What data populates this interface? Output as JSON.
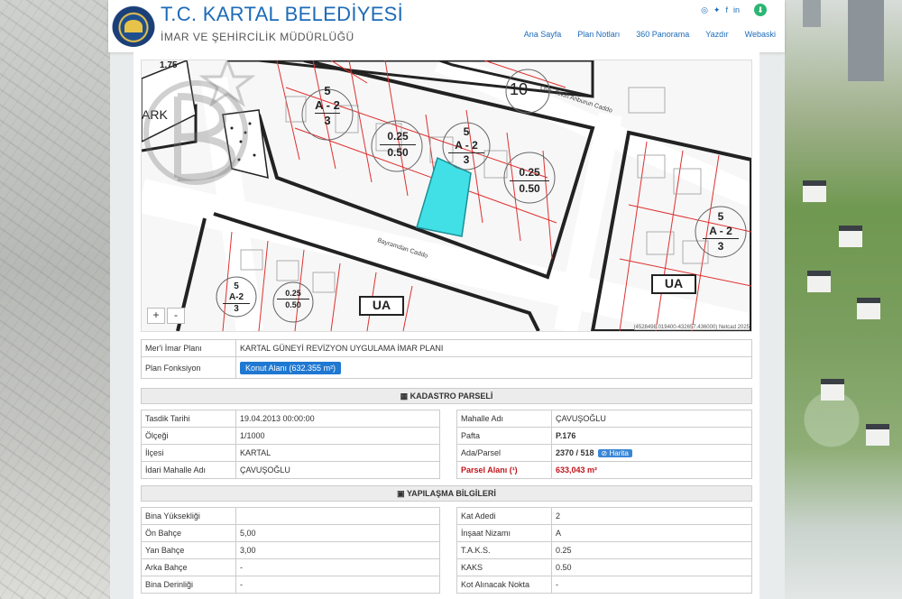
{
  "header": {
    "title": "T.C. KARTAL BELEDİYESİ",
    "subtitle": "İMAR VE ŞEHİRCİLİK MÜDÜRLÜĞÜ",
    "logo_text": "KARTAL BELEDİYESİ",
    "nav": [
      "Ana Sayfa",
      "Plan Notları",
      "360 Panorama",
      "Yazdır",
      "Webaski"
    ]
  },
  "map": {
    "labels": {
      "num_175": "1.75",
      "park": "ARK",
      "num_10": "10",
      "num_5a": "5",
      "a2a": "A - 2",
      "num_3a": "3",
      "b1": "0.25",
      "b2": "0.50",
      "num_5b": "5",
      "a2b": "A - 2",
      "num_3b": "3",
      "c1": "0.25",
      "c2": "0.50",
      "num_5c": "5",
      "a2c": "A - 2",
      "num_3c": "3",
      "num_5d": "5",
      "a2d": "A-2",
      "num_3d": "3",
      "d1": "0.25",
      "d2": "0.50",
      "ua1": "UA",
      "ua2": "UA",
      "street1": "Bayramdan Caddo",
      "street2": "Ovp. Tekin Anburun Caddo"
    },
    "zoom_in": "+",
    "zoom_out": "-",
    "attribution": "(4528498.019400-432657.436000) Netcad 2025"
  },
  "plan": {
    "rows": [
      {
        "key": "Mer'i İmar Planı",
        "value": "KARTAL GÜNEYİ REVİZYON UYGULAMA İMAR PLANI"
      },
      {
        "key": "Plan Fonksiyon",
        "value": "Konut Alanı (632.355 m²)"
      }
    ]
  },
  "kadastro": {
    "title": "KADASTRO PARSELİ",
    "left": [
      {
        "key": "Tasdik Tarihi",
        "value": "19.04.2013 00:00:00"
      },
      {
        "key": "Ölçeği",
        "value": "1/1000"
      },
      {
        "key": "İlçesi",
        "value": "KARTAL"
      },
      {
        "key": "İdari Mahalle Adı",
        "value": "ÇAVUŞOĞLU"
      }
    ],
    "right": [
      {
        "key": "Mahalle Adı",
        "value": "ÇAVUŞOĞLU"
      },
      {
        "key": "Pafta",
        "value": "P.176"
      },
      {
        "key": "Ada/Parsel",
        "value": "2370 / 518",
        "badge": "Harita"
      },
      {
        "key": "Parsel Alanı (¹)",
        "value": "633,043 m²"
      }
    ]
  },
  "yapilasma": {
    "title": "YAPILAŞMA BİLGİLERİ",
    "left": [
      {
        "key": "Bina Yüksekliği",
        "value": ""
      },
      {
        "key": "Ön Bahçe",
        "value": "5,00"
      },
      {
        "key": "Yan Bahçe",
        "value": "3,00"
      },
      {
        "key": "Arka Bahçe",
        "value": "-"
      },
      {
        "key": "Bina Derinliği",
        "value": "-"
      }
    ],
    "right": [
      {
        "key": "Kat Adedi",
        "value": "2"
      },
      {
        "key": "İnşaat Nizamı",
        "value": "A"
      },
      {
        "key": "T.A.K.S.",
        "value": "0.25"
      },
      {
        "key": "KAKS",
        "value": "0.50"
      },
      {
        "key": "Kot Alınacak Nokta",
        "value": "-"
      }
    ]
  },
  "colors": {
    "accent": "#1d6bb8",
    "parcel_highlight": "#40e0e6",
    "parcel_line": "#e03030"
  }
}
